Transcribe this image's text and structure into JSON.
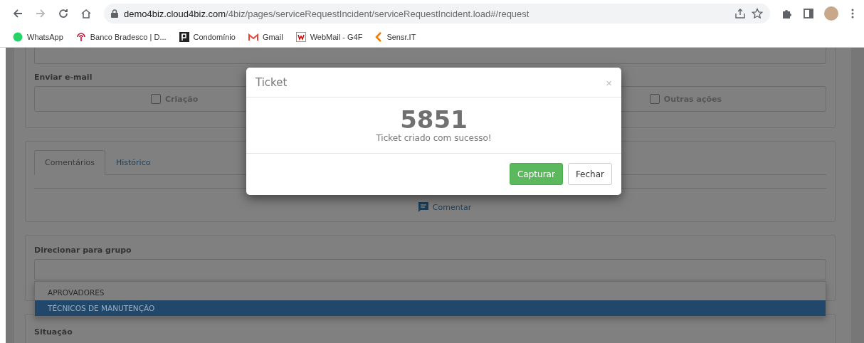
{
  "browser": {
    "url_host": "demo4biz.cloud4biz.com",
    "url_path": "/4biz/pages/serviceRequestIncident/serviceRequestIncident.load#/request",
    "bookmarks": [
      {
        "label": "WhatsApp"
      },
      {
        "label": "Banco Bradesco | D..."
      },
      {
        "label": "Condomínio"
      },
      {
        "label": "Gmail"
      },
      {
        "label": "WebMail - G4F"
      },
      {
        "label": "Sensr.IT"
      }
    ]
  },
  "form": {
    "email_label": "Enviar e-mail",
    "email_options": [
      {
        "label": "Criação",
        "checked": false
      },
      {
        "label": "Outras ações",
        "checked": false
      }
    ],
    "tabs": [
      {
        "label": "Comentários",
        "selected": true
      },
      {
        "label": "Histórico",
        "selected": false
      }
    ],
    "comment_link": "Comentar",
    "group_label": "Direcionar para grupo",
    "group_options": [
      {
        "label": "APROVADORES",
        "selected": false
      },
      {
        "label": "TÉCNICOS DE MANUTENÇÃO",
        "selected": true
      }
    ],
    "status_label": "Situação"
  },
  "modal": {
    "title": "Ticket",
    "close": "×",
    "ticket_number": "5851",
    "message": "Ticket criado com sucesso!",
    "buttons": [
      {
        "label": "Capturar",
        "kind": "primary"
      },
      {
        "label": "Fechar",
        "kind": "default"
      }
    ]
  }
}
